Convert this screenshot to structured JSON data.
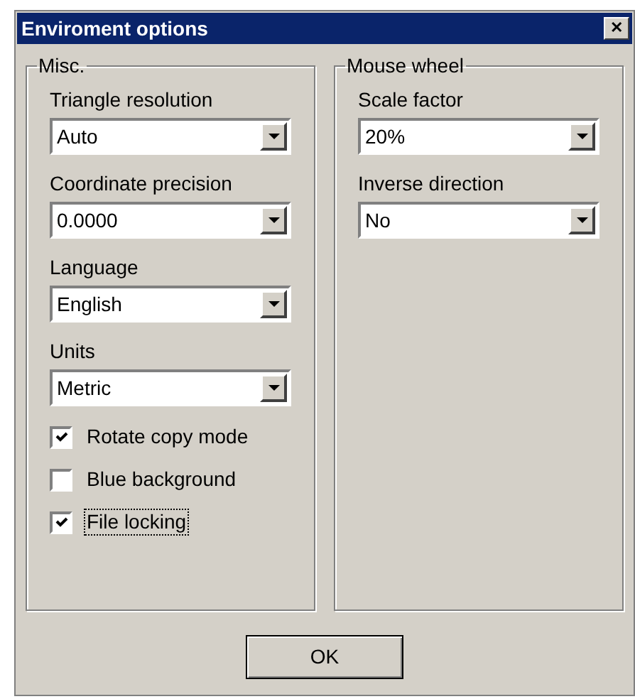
{
  "window": {
    "title": "Enviroment options",
    "close": "✕"
  },
  "groups": [
    {
      "title": "Misc.",
      "fields": [
        {
          "label": "Triangle resolution",
          "value": "Auto"
        },
        {
          "label": "Coordinate precision",
          "value": "0.0000"
        },
        {
          "label": "Language",
          "value": "English"
        },
        {
          "label": "Units",
          "value": "Metric"
        }
      ],
      "checkboxes": [
        {
          "label": "Rotate copy mode",
          "checked": true,
          "focused": false
        },
        {
          "label": "Blue background",
          "checked": false,
          "focused": false
        },
        {
          "label": "File locking",
          "checked": true,
          "focused": true
        }
      ]
    },
    {
      "title": "Mouse wheel",
      "fields": [
        {
          "label": "Scale factor",
          "value": "20%"
        },
        {
          "label": "Inverse direction",
          "value": "No"
        }
      ]
    }
  ],
  "buttons": [
    "OK"
  ]
}
